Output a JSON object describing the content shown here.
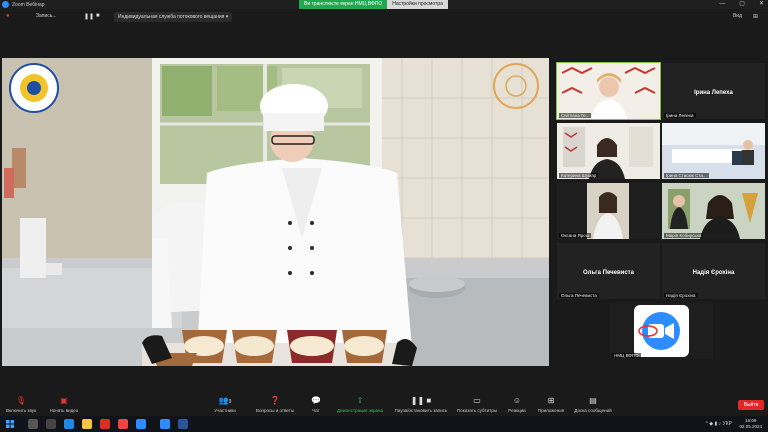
{
  "window": {
    "app_title": "Zoom Вебінар",
    "share_info": "Ви транслюєте екран НМЦ ВФПО",
    "view_settings": "Настройки просмотра",
    "controls": [
      "—",
      "▢",
      "✕"
    ]
  },
  "recording_bar": {
    "record_label": "Запись...",
    "stream_label": "Индивидуальная служба потокового вещания",
    "view_label": "Вид"
  },
  "main_video": {
    "logo_text": "ТПФК ВНАУ"
  },
  "gallery": [
    {
      "name": "Світлана Ге...",
      "active": true,
      "type": "video"
    },
    {
      "name": "Ірина Лепеха",
      "big_name": "Ірина Лепеха",
      "type": "name"
    },
    {
      "name": "Катерина Шумар",
      "type": "video"
    },
    {
      "name": "Ірина Стасюк Ста...",
      "type": "video"
    },
    {
      "name": "Оксана Ярош",
      "type": "video"
    },
    {
      "name": "Марія Кобирська",
      "type": "video"
    },
    {
      "name": "Ольга Печевиста",
      "big_name": "Ольга Печевиста",
      "type": "name"
    },
    {
      "name": "Надія Єрохіна",
      "big_name": "Надія Єрохіна",
      "type": "name"
    },
    {
      "name": "НМЦ ВФПО",
      "type": "logo"
    }
  ],
  "toolbar": {
    "mic_label": "Включить звук",
    "video_label": "Начать видео",
    "participants_label": "Участники",
    "participants_count": "9",
    "qa_label": "Вопросы и ответы",
    "chat_label": "Чат",
    "share_label": "Демонстрация экрана",
    "pause_record_label": "Пауза/остановить запись",
    "subtitles_label": "Показать субтитры",
    "reactions_label": "Реакции",
    "apps_label": "Приложения",
    "hide_messages_label": "Доска сообщений",
    "exit_label": "Выйти"
  },
  "taskbar": {
    "tray_label": "^ ◆ ▮ ♪ УКР",
    "time": "16:09",
    "date": "02.05.2024"
  },
  "colors": {
    "share_green": "#1fa84f",
    "exit_red": "#e02828",
    "zoom_blue": "#2d8cff",
    "active_outline": "#7ec63b"
  }
}
